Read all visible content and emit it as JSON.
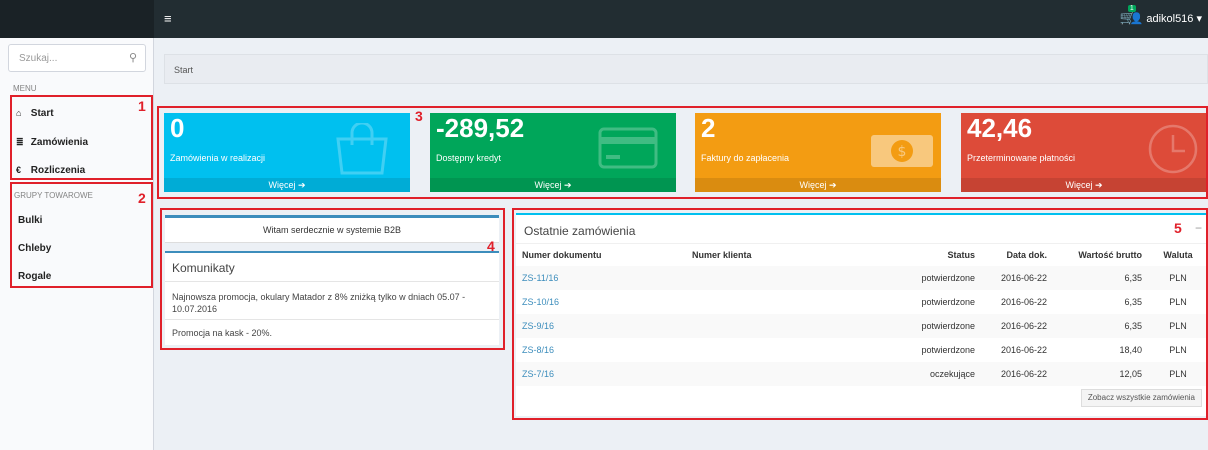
{
  "topbar": {
    "toggle_icon": "bars-icon",
    "cart_icon": "cart-icon",
    "cart_badge": "1",
    "user_label": "adikol516 ▾"
  },
  "sidebar": {
    "search_placeholder": "Szukaj...",
    "menu_header": "MENU",
    "menu_items": [
      {
        "icon": "home-icon",
        "glyph": "⌂",
        "label": "Start"
      },
      {
        "icon": "list-icon",
        "glyph": "≣",
        "label": "Zamówienia"
      },
      {
        "icon": "euro-icon",
        "glyph": "€",
        "label": "Rozliczenia"
      }
    ],
    "groups_header": "GRUPY TOWAROWE",
    "group_items": [
      "Bulki",
      "Chleby",
      "Rogale"
    ]
  },
  "annotations": [
    "1",
    "2",
    "3",
    "4",
    "5"
  ],
  "breadcrumb": "Start",
  "tiles": [
    {
      "value": "0",
      "label": "Zamówienia w realizacji",
      "more": "Więcej ➔",
      "color": "#00c0ef",
      "footer_color": "#00acd6",
      "icon": "shopping-bag-icon"
    },
    {
      "value": "-289,52",
      "label": "Dostępny kredyt",
      "more": "Więcej ➔",
      "color": "#00a65a",
      "footer_color": "#009551",
      "icon": "credit-card-icon"
    },
    {
      "value": "2",
      "label": "Faktury do zapłacenia",
      "more": "Więcej ➔",
      "color": "#f39c12",
      "footer_color": "#da8c10",
      "icon": "money-icon"
    },
    {
      "value": "42,46",
      "label": "Przeterminowane płatności",
      "more": "Więcej ➔",
      "color": "#dd4b39",
      "footer_color": "#c64333",
      "icon": "clock-icon"
    }
  ],
  "welcome": {
    "text": "Witam serdecznie w systemie B2B",
    "komunikaty_title": "Komunikaty",
    "items": [
      "Najnowsza promocja, okulary Matador z 8% zniżką tylko w dniach 05.07 - 10.07.2016",
      "Promocja na kask - 20%."
    ]
  },
  "orders": {
    "title": "Ostatnie zamówienia",
    "collapse": "−",
    "columns": [
      "Numer dokumentu",
      "Numer klienta",
      "Status",
      "Data dok.",
      "Wartość brutto",
      "Waluta"
    ],
    "rows": [
      {
        "doc": "ZS-11/16",
        "client": "",
        "status": "potwierdzone",
        "date": "2016-06-22",
        "value": "6,35",
        "currency": "PLN"
      },
      {
        "doc": "ZS-10/16",
        "client": "",
        "status": "potwierdzone",
        "date": "2016-06-22",
        "value": "6,35",
        "currency": "PLN"
      },
      {
        "doc": "ZS-9/16",
        "client": "",
        "status": "potwierdzone",
        "date": "2016-06-22",
        "value": "6,35",
        "currency": "PLN"
      },
      {
        "doc": "ZS-8/16",
        "client": "",
        "status": "potwierdzone",
        "date": "2016-06-22",
        "value": "18,40",
        "currency": "PLN"
      },
      {
        "doc": "ZS-7/16",
        "client": "",
        "status": "oczekujące",
        "date": "2016-06-22",
        "value": "12,05",
        "currency": "PLN"
      }
    ],
    "see_all": "Zobacz wszystkie zamówienia"
  }
}
